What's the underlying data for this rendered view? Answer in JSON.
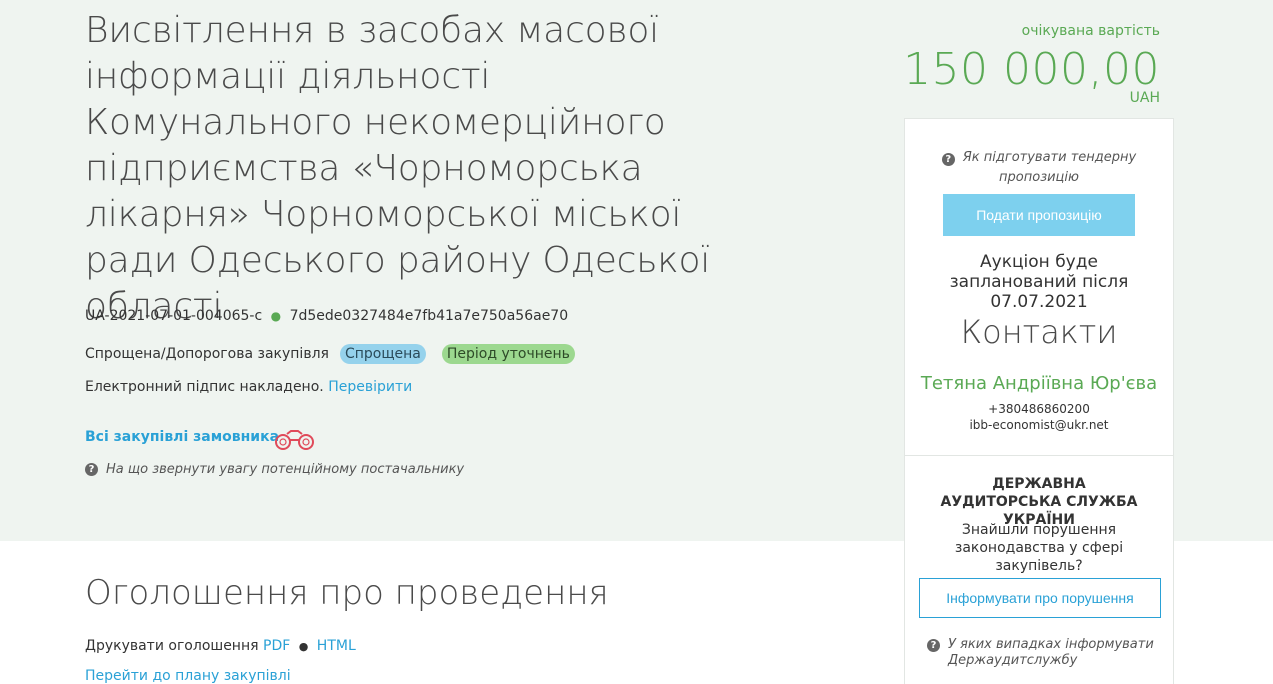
{
  "tender": {
    "title": "Висвітлення в засобах масової інформації діяльності Комунального некомерційного підприємства «Чорноморська лікарня» Чорноморської міської ради Одеського району Одеської області",
    "tender_id": "UA-2021-07-01-004065-c",
    "hash_id": "7d5ede0327484e7fb41a7e750a56ae70",
    "procurement_type": "Спрощена/Допорогова закупівля",
    "badge_type": "Спрощена",
    "badge_status": "Період уточнень",
    "signature_text": "Електронний підпис накладено.",
    "signature_check": "Перевірити",
    "all_purchases_link": "Всі закупівлі замовника",
    "supplier_hint": "На що звернути увагу потенційному постачальнику"
  },
  "announcement": {
    "title": "Оголошення про проведення",
    "print_label": "Друкувати оголошення",
    "pdf_link": "PDF",
    "html_link": "HTML",
    "plan_link": "Перейти до плану закупівлі"
  },
  "price": {
    "label": "очікувана вартість",
    "value": "150 000,00",
    "currency": "UAH"
  },
  "panel": {
    "proposal_hint": "Як підготувати тендерну пропозицію",
    "submit_button": "Подати пропозицію",
    "auction_text": "Аукціон буде запланований після 07.07.2021",
    "contacts_title": "Контакти",
    "contact_name": "Тетяна Андріївна Юр'єва",
    "contact_phone": "+380486860200",
    "contact_email": "ibb-economist@ukr.net",
    "audit_title": "ДЕРЖАВНА АУДИТОРСЬКА СЛУЖБА УКРАЇНИ",
    "audit_text": "Знайшли порушення законодавства у сфері закупівель?",
    "inform_button": "Інформувати про порушення",
    "audit_hint": "У яких випадках інформувати Держаудитслужбу"
  },
  "icons": {
    "question": "question-circle-icon",
    "binoculars": "binoculars-icon"
  },
  "colors": {
    "accent_green": "#5aa954",
    "link_blue": "#2aa1d6",
    "badge_blue": "#95d2ec",
    "badge_green": "#9cd88f",
    "button_blue": "#7dd0ee",
    "binoculars_red": "#e04a5a",
    "band_bg": "#eff4f0"
  }
}
